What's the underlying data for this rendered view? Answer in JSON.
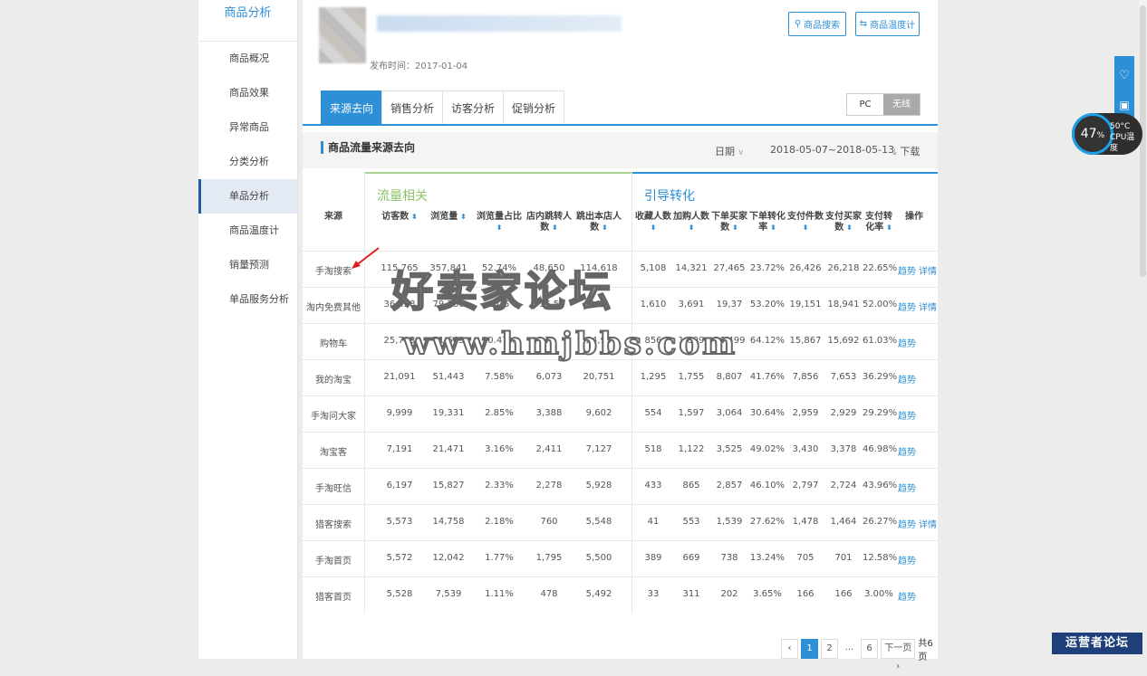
{
  "sidebar": {
    "title": "商品分析",
    "items": [
      "商品概况",
      "商品效果",
      "异常商品",
      "分类分析",
      "单品分析",
      "商品温度计",
      "销量预测",
      "单品服务分析"
    ],
    "active_index": 4
  },
  "product": {
    "publish_date": "发布时间：2017-01-04"
  },
  "header_buttons": {
    "search": "商品搜索",
    "thermometer": "商品温度计"
  },
  "tabs": [
    "来源去向",
    "销售分析",
    "访客分析",
    "促销分析"
  ],
  "device": {
    "pc": "PC",
    "wireless": "无线"
  },
  "section": {
    "title": "商品流量来源去向",
    "date_label": "日期",
    "date_range": "2018-05-07~2018-05-13",
    "download": "下载"
  },
  "groups": {
    "traffic": "流量相关",
    "conversion": "引导转化"
  },
  "columns": {
    "source": "来源",
    "visitors": "访客数",
    "views": "浏览量",
    "view_ratio": "浏览量占比",
    "store_jump": "店内跳转人数",
    "exit": "跳出本店人数",
    "favorites": "收藏人数",
    "cart": "加购人数",
    "order_buyers": "下单买家数",
    "order_rate": "下单转化率",
    "pay_items": "支付件数",
    "pay_buyers": "支付买家数",
    "pay_rate": "支付转化率",
    "ops": "操作"
  },
  "rows": [
    {
      "source": "手淘搜索",
      "v": [
        "115,765",
        "357,841",
        "52.74%",
        "48,650",
        "114,618",
        "5,108",
        "14,321",
        "27,465",
        "23.72%",
        "26,426",
        "26,218",
        "22.65%"
      ],
      "ops": [
        "趋势",
        "详情"
      ]
    },
    {
      "source": "淘内免费其他",
      "v": [
        "36,428",
        "79,266",
        "11.6",
        "16,5",
        "34,2",
        "1,610",
        "3,691",
        "19,37",
        "53.20%",
        "19,151",
        "18,941",
        "52.00%"
      ],
      "ops": [
        "趋势",
        "详情"
      ]
    },
    {
      "source": "购物车",
      "v": [
        "25,713",
        "71,663",
        "10.47%",
        "7,",
        "24,95",
        "856",
        "1,609",
        "16,499",
        "64.12%",
        "15,867",
        "15,692",
        "61.03%"
      ],
      "ops": [
        "趋势"
      ]
    },
    {
      "source": "我的淘宝",
      "v": [
        "21,091",
        "51,443",
        "7.58%",
        "6,073",
        "20,751",
        "1,295",
        "1,755",
        "8,807",
        "41.76%",
        "7,856",
        "7,653",
        "36.29%"
      ],
      "ops": [
        "趋势"
      ]
    },
    {
      "source": "手淘问大家",
      "v": [
        "9,999",
        "19,331",
        "2.85%",
        "3,388",
        "9,602",
        "554",
        "1,597",
        "3,064",
        "30.64%",
        "2,959",
        "2,929",
        "29.29%"
      ],
      "ops": [
        "趋势"
      ]
    },
    {
      "source": "淘宝客",
      "v": [
        "7,191",
        "21,471",
        "3.16%",
        "2,411",
        "7,127",
        "518",
        "1,122",
        "3,525",
        "49.02%",
        "3,430",
        "3,378",
        "46.98%"
      ],
      "ops": [
        "趋势"
      ]
    },
    {
      "source": "手淘旺信",
      "v": [
        "6,197",
        "15,827",
        "2.33%",
        "2,278",
        "5,928",
        "433",
        "865",
        "2,857",
        "46.10%",
        "2,797",
        "2,724",
        "43.96%"
      ],
      "ops": [
        "趋势"
      ]
    },
    {
      "source": "猎客搜索",
      "v": [
        "5,573",
        "14,758",
        "2.18%",
        "760",
        "5,548",
        "41",
        "553",
        "1,539",
        "27.62%",
        "1,478",
        "1,464",
        "26.27%"
      ],
      "ops": [
        "趋势",
        "详情"
      ]
    },
    {
      "source": "手淘首页",
      "v": [
        "5,572",
        "12,042",
        "1.77%",
        "1,795",
        "5,500",
        "389",
        "669",
        "738",
        "13.24%",
        "705",
        "701",
        "12.58%"
      ],
      "ops": [
        "趋势"
      ]
    },
    {
      "source": "猎客首页",
      "v": [
        "5,528",
        "7,539",
        "1.11%",
        "478",
        "5,492",
        "33",
        "311",
        "202",
        "3.65%",
        "166",
        "166",
        "3.00%"
      ],
      "ops": [
        "趋势"
      ]
    }
  ],
  "pagination": {
    "prev": "‹",
    "pages": [
      "1",
      "2",
      "...",
      "6"
    ],
    "current": "1",
    "next": "下一页 ›",
    "total": "共6页"
  },
  "watermark": {
    "line1": "好卖家论坛",
    "line2": "www.hmjbbs.com"
  },
  "cpu": {
    "percent": "47",
    "unit": "%",
    "temp": "50°C",
    "label": "CPU温度"
  },
  "badge": "运营者论坛",
  "colors": {
    "accent": "#2d8fd5",
    "traffic_group": "#8bc36a",
    "sidebar_active": "#e3eaf3"
  }
}
